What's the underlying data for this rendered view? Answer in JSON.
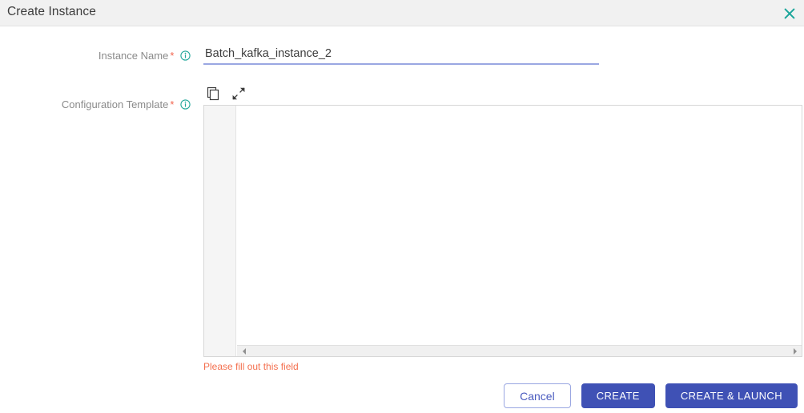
{
  "header": {
    "title": "Create Instance",
    "close_label": "close-icon"
  },
  "form": {
    "instance_name": {
      "label": "Instance Name",
      "required_marker": "*",
      "info_icon": "info-circle-icon",
      "value": "Batch_kafka_instance_2",
      "placeholder": ""
    },
    "configuration_template": {
      "label": "Configuration Template",
      "required_marker": "*",
      "info_icon": "info-circle-icon",
      "value": "",
      "placeholder": "",
      "toolbar": {
        "copy_icon": "copy-icon",
        "expand_icon": "expand-diagonal-icon"
      },
      "scrollbar": {
        "left_arrow": "chevron-left-icon",
        "right_arrow": "chevron-right-icon"
      },
      "error_message": "Please fill out this field"
    }
  },
  "footer": {
    "cancel_label": "Cancel",
    "create_label": "CREATE",
    "create_launch_label": "CREATE & LAUNCH"
  },
  "colors": {
    "header_bg": "#f1f1f1",
    "accent_teal": "#21a79a",
    "primary_blue": "#3f51b5",
    "error_orange": "#f4704f",
    "required_star": "#f2654f",
    "input_underline": "#9aa7e2"
  }
}
